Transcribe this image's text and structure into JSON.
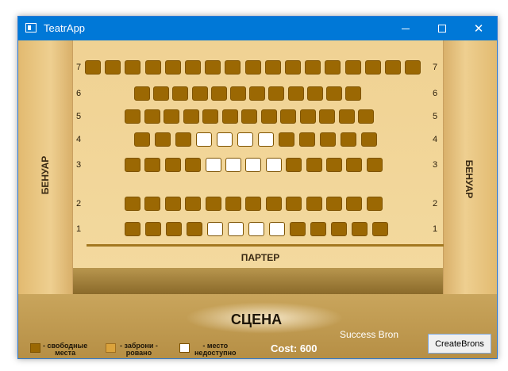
{
  "window": {
    "title": "TeatrApp",
    "minimize_glyph": "minimize-icon",
    "maximize_glyph": "maximize-icon",
    "close_glyph": "✕"
  },
  "hall": {
    "box_left_label": "БЕНУАР",
    "box_right_label": "БЕНУАР",
    "parter_label": "ПАРТЕР",
    "stage_label": "СЦЕНА"
  },
  "colors": {
    "free": "#9b6803",
    "booked": "#dba33c",
    "unavailable": "#ffffff",
    "titlebar": "#0078d7"
  },
  "rows": [
    {
      "number": "7",
      "seats": [
        "free",
        "free",
        "free",
        "free",
        "free",
        "free",
        "free",
        "free",
        "free",
        "free",
        "free",
        "free",
        "free",
        "free",
        "free",
        "free",
        "free"
      ]
    },
    {
      "number": "6",
      "seats": [
        "free",
        "free",
        "free",
        "free",
        "free",
        "free",
        "free",
        "free",
        "free",
        "free",
        "free",
        "free"
      ]
    },
    {
      "number": "5",
      "seats": [
        "free",
        "free",
        "free",
        "free",
        "free",
        "free",
        "free",
        "free",
        "free",
        "free",
        "free",
        "free",
        "free"
      ]
    },
    {
      "number": "4",
      "seats": [
        "free",
        "free",
        "free",
        "unavailable",
        "unavailable",
        "unavailable",
        "unavailable",
        "free",
        "free",
        "free",
        "free",
        "free"
      ]
    },
    {
      "number": "3",
      "seats": [
        "free",
        "free",
        "free",
        "free",
        "unavailable",
        "unavailable",
        "unavailable",
        "unavailable",
        "free",
        "free",
        "free",
        "free",
        "free"
      ]
    },
    {
      "number": "2",
      "seats": [
        "free",
        "free",
        "free",
        "free",
        "free",
        "free",
        "free",
        "free",
        "free",
        "free",
        "free",
        "free",
        "free"
      ]
    },
    {
      "number": "1",
      "seats": [
        "free",
        "free",
        "free",
        "free",
        "unavailable",
        "unavailable",
        "unavailable",
        "unavailable",
        "free",
        "free",
        "free",
        "free",
        "free"
      ]
    }
  ],
  "legend": {
    "free_line1": "- свободные",
    "free_line2": "места",
    "booked_line1": "- заброни -",
    "booked_line2": "ровано",
    "unavailable_line1": "-  место",
    "unavailable_line2": "недоступно"
  },
  "footer": {
    "cost": "Cost: 600",
    "status": "Success Bron",
    "create_button": "CreateBrons"
  }
}
